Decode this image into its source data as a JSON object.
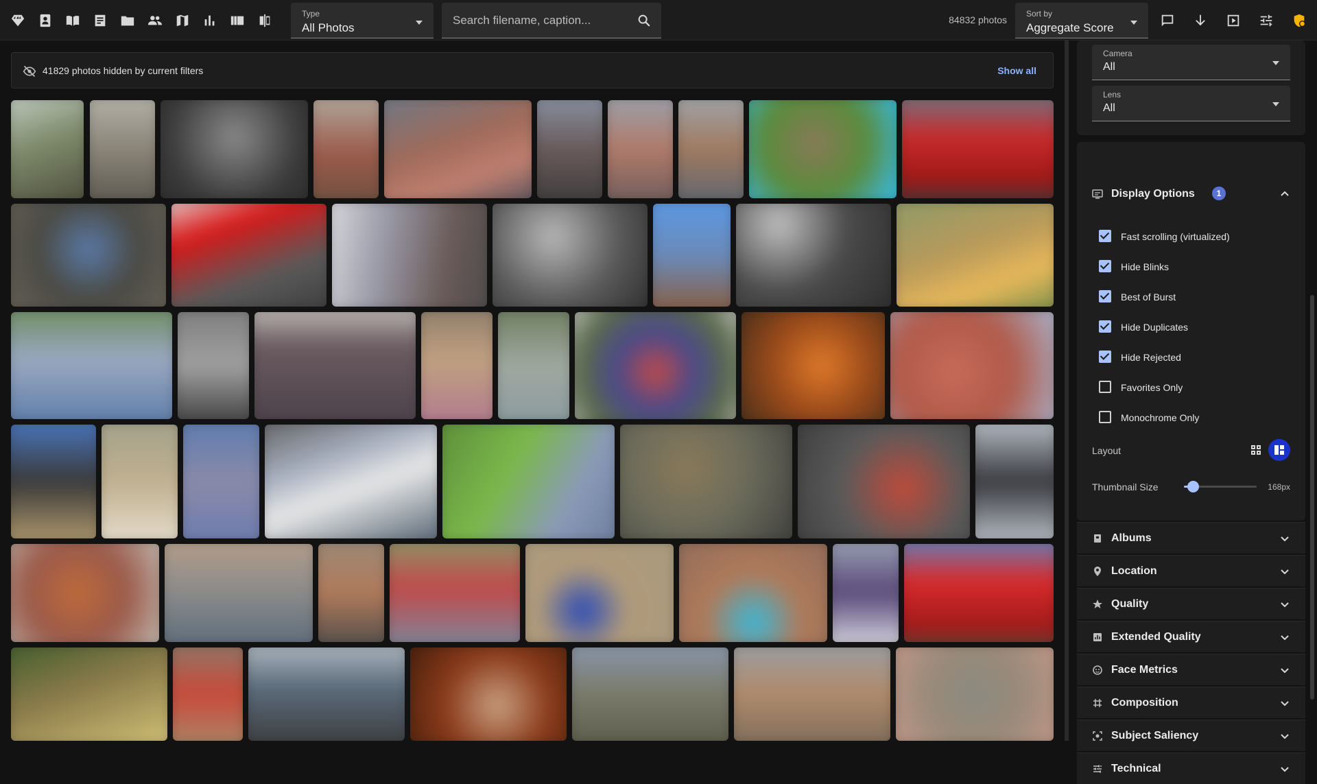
{
  "toolbar": {
    "icons": [
      "diamond-icon",
      "person-badge-icon",
      "book-icon",
      "note-icon",
      "folder-icon",
      "people-icon",
      "map-icon",
      "bar-chart-icon",
      "gallery-icon",
      "compare-icon"
    ],
    "type_label": "Type",
    "type_value": "All Photos",
    "search_placeholder": "Search filename, caption...",
    "photo_count": "84832 photos",
    "sort_label": "Sort by",
    "sort_value": "Aggregate Score",
    "right_icons": [
      "comment-icon",
      "arrow-down-icon",
      "slideshow-icon",
      "filter-tune-icon",
      "stats-user-icon"
    ],
    "accent": "#f5b400"
  },
  "banner": {
    "message": "41829 photos hidden by current filters",
    "action": "Show all"
  },
  "sidebar": {
    "camera_label": "Camera",
    "camera_value": "All",
    "lens_label": "Lens",
    "lens_value": "All",
    "display_options": {
      "title": "Display Options",
      "badge": "1",
      "options": [
        {
          "label": "Fast scrolling (virtualized)",
          "checked": true
        },
        {
          "label": "Hide Blinks",
          "checked": true
        },
        {
          "label": "Best of Burst",
          "checked": true
        },
        {
          "label": "Hide Duplicates",
          "checked": true
        },
        {
          "label": "Hide Rejected",
          "checked": true
        },
        {
          "label": "Favorites Only",
          "checked": false
        },
        {
          "label": "Monochrome Only",
          "checked": false
        }
      ],
      "layout_label": "Layout",
      "thumbnail_label": "Thumbnail Size",
      "thumbnail_value": "168px",
      "thumbnail_fraction": 0.12
    },
    "sections": [
      {
        "title": "Albums",
        "icon": "album-icon"
      },
      {
        "title": "Location",
        "icon": "location-pin-icon"
      },
      {
        "title": "Quality",
        "icon": "star-icon"
      },
      {
        "title": "Extended Quality",
        "icon": "chart-box-icon"
      },
      {
        "title": "Face Metrics",
        "icon": "face-icon"
      },
      {
        "title": "Composition",
        "icon": "grid-hash-icon"
      },
      {
        "title": "Subject Saliency",
        "icon": "focus-icon"
      },
      {
        "title": "Technical",
        "icon": "tune-icon"
      }
    ]
  },
  "colors": {
    "checkbox_on": "#a8c1ff",
    "link": "#8ab4ff",
    "badge": "#5a72d6",
    "layout_active": "#1a33c9"
  }
}
